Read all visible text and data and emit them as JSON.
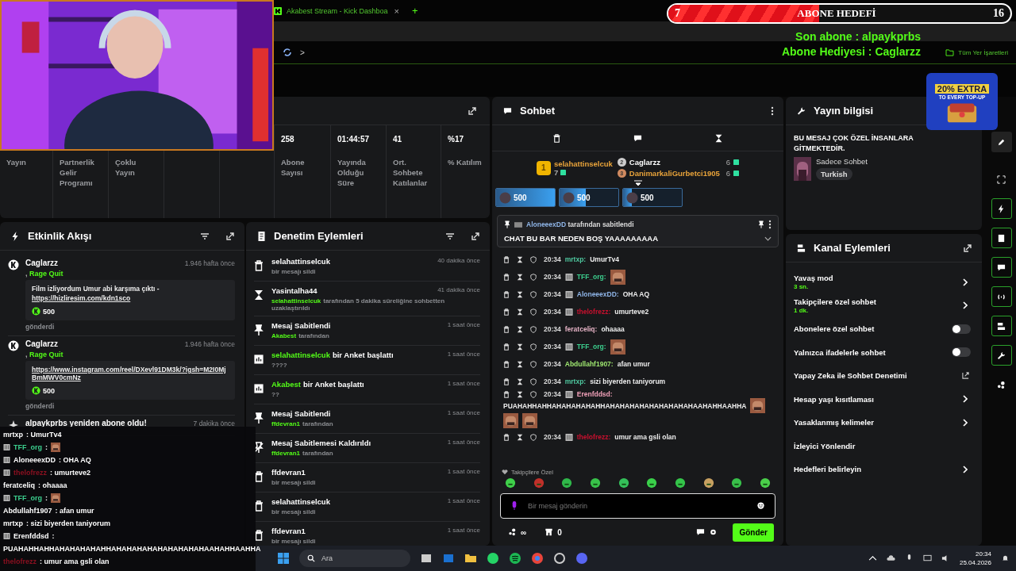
{
  "browser": {
    "tab_title": "Akabest Stream - Kick Dashboa",
    "tab_close": "×",
    "new_tab": "+",
    "nav_arrow": ">",
    "bookmarks": "Tüm Yer İşaretleri"
  },
  "goal": {
    "title": "ABONE HEDEFİ",
    "current": "7",
    "target": "16",
    "level": 0.44
  },
  "overlay_lines": [
    "Son abone : alpaykprbs",
    "Abone Hediyesi : Caglarzz"
  ],
  "ad": {
    "headline": "20% EXTRA",
    "subline": "TO EVERY TOP-UP"
  },
  "stats": [
    {
      "label": "Yayın"
    },
    {
      "label": "Partnerlik Gelir Programı"
    },
    {
      "label": "Çoklu Yayın"
    },
    {
      "value": "258",
      "label": "Abone Sayısı"
    },
    {
      "value": "01:44:57",
      "label": "Yayında Olduğu Süre"
    },
    {
      "value": "41",
      "label": "Ort. Sohbete Katılanlar"
    },
    {
      "value": "%17",
      "label": "% Katılım"
    }
  ],
  "events": {
    "title": "Etkinlik Akışı",
    "items": [
      {
        "kind": "tip",
        "name": "Caglarzz",
        "time": "1.946 hafta önce",
        "separator": ",",
        "tag": "Rage Quit",
        "message": "Film izliyordum Umur abi karşıma çıktı -",
        "link": "https://hizliresim.com/kdn1sco",
        "amount": "500",
        "footer": "gönderdi"
      },
      {
        "kind": "tip",
        "name": "Caglarzz",
        "time": "1.946 hafta önce",
        "separator": ",",
        "tag": "Rage Quit",
        "link": "https://www.instagram.com/reel/DXevl91DM3k/?igsh=M2I0MjBmMWV0cmNz",
        "amount": "500",
        "footer": "gönderdi"
      },
      {
        "kind": "resub",
        "name": "alpaykprbs yeniden abone oldu!",
        "time": "7 dakika önce"
      }
    ]
  },
  "moderation": {
    "title": "Denetim Eylemleri",
    "items": [
      {
        "kind": "delete",
        "title": "selahattinselcuk",
        "sub": "bir mesajı sildi",
        "time": "40 dakika önce"
      },
      {
        "kind": "timeout",
        "title": "Yasintalha44",
        "sub_actor": "selahattinselcuk",
        "sub": "tarafından 5 dakika süreliğine sohbetten uzaklaştırıldı",
        "time": "41 dakika önce"
      },
      {
        "kind": "pin",
        "title": "Mesaj Sabitlendi",
        "sub_actor": "Akabest",
        "sub": "tarafından",
        "time": "1 saat önce"
      },
      {
        "kind": "poll",
        "title_actor": "selahattinselcuk",
        "title": "bir Anket başlattı",
        "sub": "????",
        "time": "1 saat önce"
      },
      {
        "kind": "poll",
        "title_actor": "Akabest",
        "title": "bir Anket başlattı",
        "sub": "??",
        "time": "1 saat önce"
      },
      {
        "kind": "pin",
        "title": "Mesaj Sabitlendi",
        "sub_actor": "ffdevran1",
        "sub": "tarafından",
        "time": "1 saat önce"
      },
      {
        "kind": "unpin",
        "title": "Mesaj Sabitlemesi Kaldırıldı",
        "sub_actor": "ffdevran1",
        "sub": "tarafından",
        "time": "1 saat önce"
      },
      {
        "kind": "delete",
        "title": "ffdevran1",
        "sub": "bir mesajı sildi",
        "time": "1 saat önce"
      },
      {
        "kind": "delete",
        "title": "selahattinselcuk",
        "sub": "bir mesajı sildi",
        "time": "1 saat önce"
      },
      {
        "kind": "delete",
        "title": "ffdevran1",
        "sub": "bir mesajı sildi",
        "time": "1 saat önce"
      }
    ]
  },
  "chat": {
    "title": "Sohbet",
    "leader": {
      "rank": "1",
      "name": "selahattinselcuk",
      "count": "7"
    },
    "runners": [
      {
        "rank": "2",
        "name": "Caglarzz",
        "count": "6"
      },
      {
        "rank": "3",
        "name": "DanimarkaliGurbetci1905",
        "count": "6"
      }
    ],
    "gifts": [
      {
        "amount": "500",
        "level": 1
      },
      {
        "amount": "500",
        "level": 0.45
      },
      {
        "amount": "500",
        "level": 0.15
      }
    ],
    "pinned": {
      "by": "AloneeexDD",
      "by_suffix": "tarafından sabitlendi",
      "text": "CHAT BU BAR NEDEN BOŞ YAAAAAAAAA"
    },
    "messages": [
      {
        "time": "20:34",
        "badge": false,
        "name": "mrtxp:",
        "color": "#4fc9a0",
        "text": "UmurTv4"
      },
      {
        "time": "20:34",
        "badge": true,
        "name": "TFF_org:",
        "color": "#3ccf8e"
      },
      {
        "time": "20:34",
        "badge": true,
        "name": "AloneeexDD:",
        "color": "#8fb5e8",
        "text": "OHA AQ"
      },
      {
        "time": "20:34",
        "badge": true,
        "name": "thelofrezz:",
        "color": "#c8102e",
        "text": "umurteve2"
      },
      {
        "time": "20:34",
        "badge": false,
        "name": "feratceliq:",
        "color": "#e6b3c6",
        "text": "ohaaaa"
      },
      {
        "time": "20:34",
        "badge": true,
        "name": "TFF_org:",
        "color": "#3ccf8e"
      },
      {
        "time": "20:34",
        "badge": false,
        "name": "Abdullahf1907:",
        "color": "#9fe870",
        "text": "afan umur"
      },
      {
        "time": "20:34",
        "badge": false,
        "name": "mrtxp:",
        "color": "#4fc9a0",
        "text": "sizi biyerden taniyorum"
      },
      {
        "time": "20:34",
        "badge": true,
        "name": "Erenfddsd:",
        "color": "#f0a0b8",
        "text": "PUAHAHHAHHAHAHAHAHAHHAHAHAHAHAHAHAHAHAHAAHAHHAAHHA"
      },
      {
        "time": "20:34",
        "badge": true,
        "name": "thelofrezz:",
        "color": "#c8102e",
        "text": "umur ama gsli olan"
      }
    ],
    "emote_label": "Takipçilere Özel",
    "placeholder": "Bir mesaj gönderin",
    "points": "∞",
    "store_count": "0",
    "send": "Gönder"
  },
  "stream_info": {
    "title": "Yayın bilgisi",
    "message": "BU MESAJ ÇOK ÖZEL İNSANLARA GİTMEKTEDİR.",
    "category": "Sadece Sohbet",
    "tag": "Turkish"
  },
  "channel_actions": {
    "title": "Kanal Eylemleri",
    "items": [
      {
        "kind": "chevron",
        "label": "Yavaş mod",
        "sub": "3 sn."
      },
      {
        "kind": "chevron",
        "label": "Takipçilere özel sohbet",
        "sub": "1 dk."
      },
      {
        "kind": "toggle",
        "label": "Abonelere özel sohbet",
        "on": false
      },
      {
        "kind": "toggle",
        "label": "Yalnızca ifadelerle sohbet",
        "on": false
      },
      {
        "kind": "external",
        "label": "Yapay Zeka ile Sohbet Denetimi"
      },
      {
        "kind": "chevron",
        "label": "Hesap yaşı kısıtlaması"
      },
      {
        "kind": "chevron",
        "label": "Yasaklanmış kelimeler"
      },
      {
        "kind": "plain",
        "label": "İzleyici Yönlendir"
      },
      {
        "kind": "chevron",
        "label": "Hedefleri belirleyin"
      }
    ]
  },
  "sidebar": [
    {
      "kind": "edit",
      "on": false
    },
    {
      "kind": "focus",
      "on": false
    },
    {
      "kind": "bolt",
      "on": true
    },
    {
      "kind": "doc",
      "on": true
    },
    {
      "kind": "chat",
      "on": true
    },
    {
      "kind": "broadcast",
      "on": true
    },
    {
      "kind": "channel",
      "on": true
    },
    {
      "kind": "wrench",
      "on": true
    },
    {
      "kind": "dots",
      "on": false
    }
  ],
  "stream_chat": [
    {
      "badge": false,
      "name": "mrtxp",
      "color": "#ffffff",
      "text": ": UmurTv4"
    },
    {
      "badge": true,
      "name": "TFF_org",
      "color": "#3ccf8e",
      "text": ":"
    },
    {
      "badge": true,
      "name": "AloneeexDD",
      "color": "#ffffff",
      "text": ": OHA AQ"
    },
    {
      "badge": true,
      "name": "thelofrezz",
      "color": "#8a1020",
      "text": ": umurteve2"
    },
    {
      "badge": false,
      "name": "feratceliq",
      "color": "#ffffff",
      "text": ": ohaaaa"
    },
    {
      "badge": true,
      "name": "TFF_org",
      "color": "#3ccf8e",
      "text": ":"
    },
    {
      "badge": false,
      "name": "Abdullahf1907",
      "color": "#ffffff",
      "text": ": afan umur"
    },
    {
      "badge": false,
      "name": "mrtxp",
      "color": "#ffffff",
      "text": ": sizi biyerden taniyorum"
    },
    {
      "badge": true,
      "name": "Erenfddsd",
      "color": "#ffffff",
      "text": ":"
    },
    {
      "badge": false,
      "text": "PUAHAHHAHHAHAHAHAHAHHAHAHAHAHAHAHAHAHAHAAHAHHAAHHA"
    },
    {
      "badge": false,
      "name": "thelofrezz",
      "color": "#8a1020",
      "text": ": umur ama gsli olan"
    }
  ],
  "taskbar": {
    "search_placeholder": "Ara",
    "time": "20:34",
    "date": "25.04.2026"
  }
}
